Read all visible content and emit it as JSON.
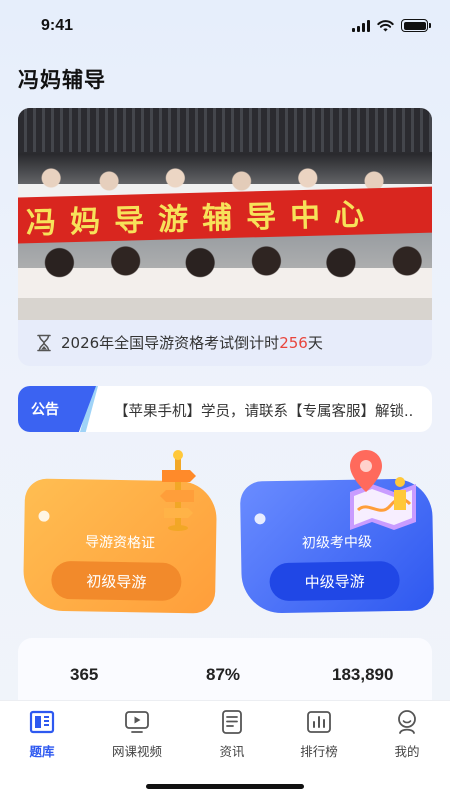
{
  "status_bar": {
    "time": "9:41"
  },
  "header": {
    "title": "冯妈辅导"
  },
  "banner": {
    "photo_banner_text": "冯妈导游辅导中心",
    "countdown": {
      "prefix": "2026年全国导游资格考试倒计时",
      "days": "256",
      "suffix": "天"
    }
  },
  "notice": {
    "tag": "公告",
    "text": "【苹果手机】学员，请联系【专属客服】解锁.."
  },
  "cards": [
    {
      "caption": "导游资格证",
      "button": "初级导游",
      "color": "#ff9e3a",
      "icon": "signpost-icon"
    },
    {
      "caption": "初级考中级",
      "button": "中级导游",
      "color": "#2e58f0",
      "icon": "map-pin-icon"
    }
  ],
  "stats": [
    "365",
    "87%",
    "183,890"
  ],
  "tabbar": {
    "active": "题库",
    "items": [
      {
        "label": "题库",
        "icon": "question-bank-icon"
      },
      {
        "label": "网课视频",
        "icon": "video-icon"
      },
      {
        "label": "资讯",
        "icon": "news-icon"
      },
      {
        "label": "排行榜",
        "icon": "ranking-icon"
      },
      {
        "label": "我的",
        "icon": "profile-icon"
      }
    ]
  },
  "colors": {
    "accent": "#2e59f0",
    "countdown_days": "#e8453c",
    "orange": "#ff9e3a",
    "blue": "#2e58f0"
  }
}
